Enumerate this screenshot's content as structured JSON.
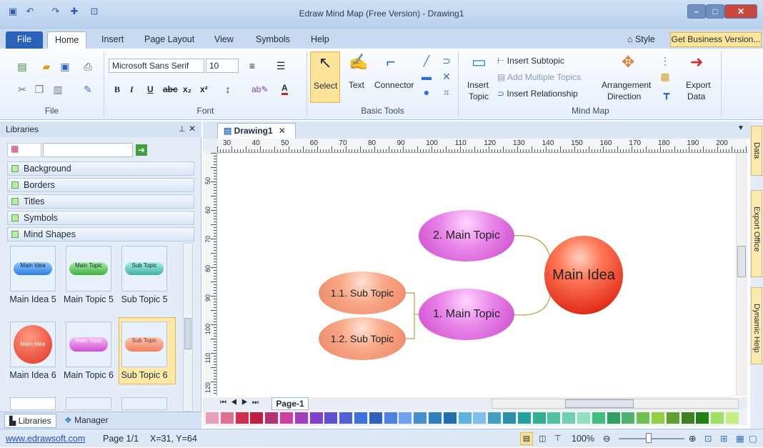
{
  "titlebar": {
    "title": "Edraw Mind Map (Free Version) - Drawing1"
  },
  "tabs": {
    "file": "File",
    "home": "Home",
    "insert": "Insert",
    "page_layout": "Page Layout",
    "view": "View",
    "symbols": "Symbols",
    "help": "Help",
    "style": "Style",
    "business": "Get Business Version..."
  },
  "ribbon": {
    "file_group": "File",
    "font_group": "Font",
    "font_name": "Microsoft Sans Serif",
    "font_size": "10",
    "basic_tools_group": "Basic Tools",
    "select": "Select",
    "text": "Text",
    "connector": "Connector",
    "mind_map_group": "Mind Map",
    "insert_topic_1": "Insert",
    "insert_topic_2": "Topic",
    "insert_subtopic": "Insert Subtopic",
    "add_multiple_topics": "Add Multiple Topics",
    "insert_relationship": "Insert Relationship",
    "arrangement_1": "Arrangement",
    "arrangement_2": "Direction",
    "export_1": "Export",
    "export_2": "Data"
  },
  "libraries": {
    "title": "Libraries",
    "categories": [
      "Background",
      "Borders",
      "Titles",
      "Symbols",
      "Mind Shapes"
    ],
    "shapes": [
      {
        "label": "Main Idea 5",
        "inner": "Main Idea"
      },
      {
        "label": "Main Topic 5",
        "inner": "Main Topic"
      },
      {
        "label": "Sub Topic 5",
        "inner": "Sub Topic"
      },
      {
        "label": "Main Idea 6",
        "inner": "Main Idea"
      },
      {
        "label": "Main Topic 6",
        "inner": "Main Topic"
      },
      {
        "label": "Sub Topic 6",
        "inner": "Sub Topic"
      }
    ],
    "tab_libraries": "Libraries",
    "tab_manager": "Manager"
  },
  "document": {
    "tab": "Drawing1",
    "page_tab": "Page-1",
    "ruler_top": [
      "30",
      "40",
      "50",
      "60",
      "70",
      "80",
      "90",
      "100",
      "110",
      "120",
      "130",
      "140",
      "150",
      "160",
      "170",
      "180",
      "190",
      "200"
    ],
    "ruler_left": [
      "50",
      "60",
      "70",
      "80",
      "90",
      "100",
      "110",
      "120"
    ]
  },
  "mindmap": {
    "main_idea": "Main Idea",
    "topic1": "1. Main Topic",
    "topic2": "2. Main Topic",
    "sub1": "1.1. Sub Topic",
    "sub2": "1.2. Sub Topic"
  },
  "dock": {
    "data": "Data",
    "export": "Export Office",
    "help": "Dynamic Help"
  },
  "status": {
    "link": "www.edrawsoft.com",
    "page": "Page 1/1",
    "coords": "X=31, Y=64",
    "zoom": "100%"
  },
  "palette": [
    "#e8a0b8",
    "#e07090",
    "#d03050",
    "#c02040",
    "#b83070",
    "#d040a0",
    "#a040c0",
    "#8040d0",
    "#6050d0",
    "#5060d8",
    "#4070e0",
    "#3060c0",
    "#5080e0",
    "#70a0f0",
    "#4090d0",
    "#3080c0",
    "#2070b0",
    "#60b0e0",
    "#80c0e8",
    "#40a0c0",
    "#3090a8",
    "#20a0a0",
    "#30b090",
    "#50c0a0",
    "#70d0b0",
    "#90e0c0",
    "#40c080",
    "#30a060",
    "#50b070",
    "#70c050",
    "#90d040",
    "#60a030",
    "#408020",
    "#208010",
    "#a0e060",
    "#c0f080"
  ]
}
